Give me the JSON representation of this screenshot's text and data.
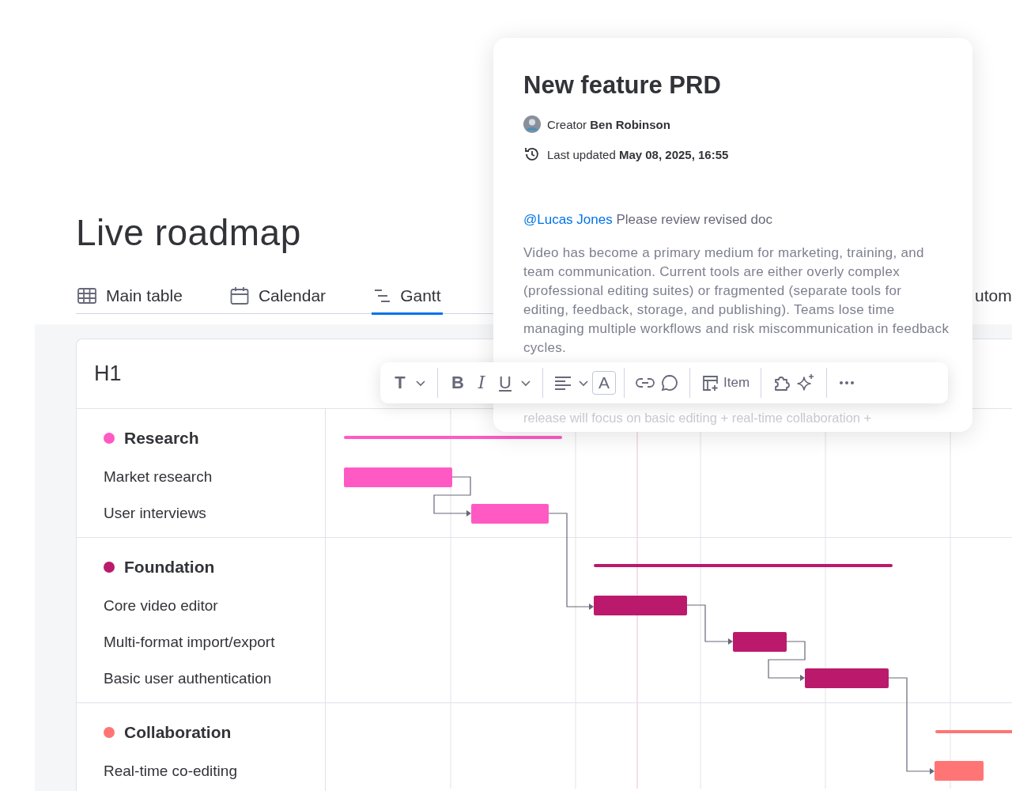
{
  "page": {
    "title": "Live roadmap"
  },
  "tabs": [
    {
      "label": "Main table",
      "kind": "table",
      "selected": false
    },
    {
      "label": "Calendar",
      "kind": "calendar",
      "selected": false
    },
    {
      "label": "Gantt",
      "kind": "gantt",
      "selected": true
    },
    {
      "label": "utom",
      "kind": "none",
      "selected": false
    }
  ],
  "board": {
    "header": "H1",
    "groups": [
      {
        "name": "Research",
        "color": "#ff5ac4",
        "items": [
          "Market research",
          "User interviews"
        ]
      },
      {
        "name": "Foundation",
        "color": "#bb1a6c",
        "items": [
          "Core video editor",
          "Multi-format import/export",
          "Basic user authentication"
        ]
      },
      {
        "name": "Collaboration",
        "color": "#ff7575",
        "items": [
          "Real-time co-editing"
        ]
      }
    ]
  },
  "doc": {
    "title": "New feature PRD",
    "creator_label": "Creator",
    "creator": "Ben Robinson",
    "updated_label": "Last updated",
    "updated": "May 08, 2025, 16:55",
    "mention": "@Lucas Jones",
    "comment": "Please review revised doc",
    "body": "Video has become a primary medium for marketing, training, and team communication. Current tools are either overly complex (professional editing suites) or fragmented (separate tools for editing, feedback, storage, and publishing). Teams lose time managing multiple workflows and risk miscommunication in feedback cycles.",
    "body_tail": "release will focus on basic editing + real-time collaboration +"
  },
  "toolbar": {
    "style_glyph": "T",
    "bold_glyph": "B",
    "italic_glyph": "I",
    "underline_glyph": "U",
    "color_glyph": "A",
    "item_button": "Item"
  }
}
